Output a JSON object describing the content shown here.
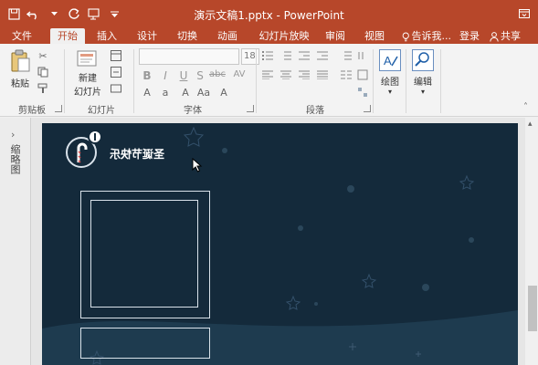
{
  "window": {
    "title": "演示文稿1.pptx - PowerPoint"
  },
  "quick_access": [
    {
      "name": "save-icon"
    },
    {
      "name": "undo-icon"
    },
    {
      "name": "redo-icon"
    },
    {
      "name": "presentation-icon"
    },
    {
      "name": "customize-icon"
    }
  ],
  "tabs": [
    {
      "label": "文件",
      "active": false
    },
    {
      "label": "开始",
      "active": true
    },
    {
      "label": "插入",
      "active": false
    },
    {
      "label": "设计",
      "active": false
    },
    {
      "label": "切换",
      "active": false
    },
    {
      "label": "动画",
      "active": false
    },
    {
      "label": "幻灯片放映",
      "active": false
    },
    {
      "label": "审阅",
      "active": false
    },
    {
      "label": "视图",
      "active": false
    }
  ],
  "tell_me": "告诉我...",
  "login": "登录",
  "share": "共享",
  "ribbon": {
    "clipboard": {
      "paste": "粘贴",
      "group": "剪贴板"
    },
    "slides": {
      "new_slide_line1": "新建",
      "new_slide_line2": "幻灯片",
      "group": "幻灯片"
    },
    "font": {
      "size_value": "18",
      "group": "字体",
      "bold": "B",
      "italic": "I",
      "underline": "U",
      "shadow": "S",
      "strike": "abc",
      "spacing": "AV"
    },
    "paragraph": {
      "group": "段落"
    },
    "drawing": {
      "label": "绘图"
    },
    "editing": {
      "label": "编辑"
    }
  },
  "thumbnails_label": "缩略图",
  "slide": {
    "title": "圣诞节快乐",
    "background_color": "#142a3b"
  },
  "colors": {
    "brand": "#b7472a",
    "slide_bg": "#142a3b"
  }
}
